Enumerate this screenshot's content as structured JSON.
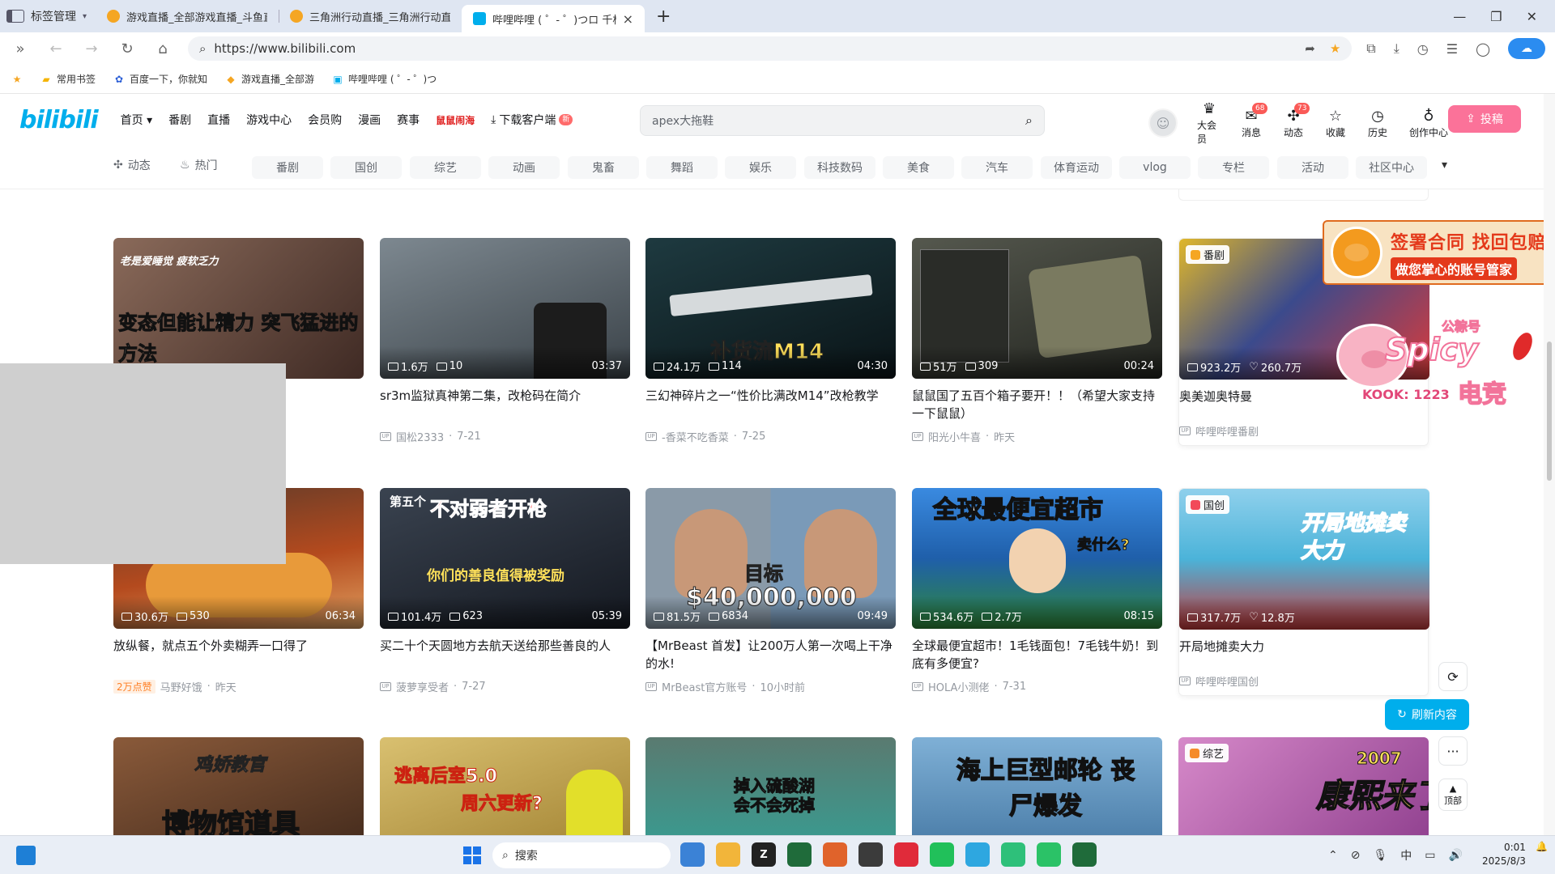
{
  "browser": {
    "tab_control_label": "标签管理",
    "tabs": [
      {
        "title": "游戏直播_全部游戏直播_斗鱼直播",
        "color": "#f5a623"
      },
      {
        "title": "三角洲行动直播_三角洲行动直播",
        "color": "#f5a623"
      },
      {
        "title": "哔哩哔哩 ( ゜- ゜)つロ 千杯~-b",
        "color": "#00aeec"
      }
    ],
    "url": "https://www.bilibili.com",
    "bookmarks": [
      {
        "label": "常用书签",
        "icon": "bookmark-folder-icon"
      },
      {
        "label": "百度一下，你就知",
        "icon": "baidu-icon"
      },
      {
        "label": "游戏直播_全部游",
        "icon": "douyu-icon"
      },
      {
        "label": "哔哩哔哩 ( ゜- ゜)つ",
        "icon": "bilibili-icon"
      }
    ]
  },
  "header": {
    "logo": "bilibili",
    "nav": [
      "首页",
      "番剧",
      "直播",
      "游戏中心",
      "会员购",
      "漫画",
      "赛事"
    ],
    "hot_label": "鼠鼠闹海",
    "download_label": "下载客户端",
    "new_badge": "新",
    "search_placeholder": "apex大拖鞋",
    "right": [
      {
        "label": "大会员",
        "icon": "vip-icon",
        "count": ""
      },
      {
        "label": "消息",
        "icon": "message-icon",
        "count": "68"
      },
      {
        "label": "动态",
        "icon": "dynamic-icon",
        "count": "73"
      },
      {
        "label": "收藏",
        "icon": "favorite-icon",
        "count": ""
      },
      {
        "label": "历史",
        "icon": "history-icon",
        "count": ""
      },
      {
        "label": "创作中心",
        "icon": "creator-icon",
        "count": ""
      }
    ],
    "upload_label": "投稿"
  },
  "channels": {
    "special": [
      {
        "label": "动态",
        "icon": "dynamic-icon"
      },
      {
        "label": "热门",
        "icon": "fire-icon"
      }
    ],
    "items": [
      "番剧",
      "国创",
      "综艺",
      "动画",
      "鬼畜",
      "舞蹈",
      "娱乐",
      "科技数码",
      "美食",
      "汽车",
      "体育运动",
      "vlog",
      "专栏",
      "活动",
      "社区中心"
    ]
  },
  "feed": {
    "row1": [
      {
        "thumb_text": "变态但能让精力 突飞猛进的方法",
        "overlay": "老是爱睡觉 疲软乏力",
        "views": "",
        "comments": "",
        "duration": "",
        "title": "",
        "up": "",
        "date": "",
        "bg": "#6b4a3f"
      },
      {
        "thumb_text": "",
        "views": "1.6万",
        "comments": "10",
        "duration": "03:37",
        "title": "sr3m监狱真神第二集，改枪码在简介",
        "up": "国松2333",
        "date": "7-21",
        "bg": "#4a5258"
      },
      {
        "thumb_text": "补货流M14",
        "views": "24.1万",
        "comments": "114",
        "duration": "04:30",
        "title": "三幻神碎片之一“性价比满改M14”改枪教学",
        "up": "-香菜不吃香菜",
        "date": "7-25",
        "bg": "#16252a"
      },
      {
        "thumb_text": "",
        "views": "51万",
        "comments": "309",
        "duration": "00:24",
        "title": "鼠鼠国了五百个箱子要开！！（希望大家支持一下鼠鼠）",
        "up": "阳光小牛喜",
        "date": "昨天",
        "bg": "#3d3f39"
      },
      {
        "thumb_text": "",
        "badge": "番剧",
        "badge_color": "#f5a623",
        "views": "923.2万",
        "likes": "260.7万",
        "title": "奥美迦奥特曼",
        "up": "哔哩哔哩番剧",
        "date": "",
        "bg": "#3b4a8c"
      }
    ],
    "row2": [
      {
        "views": "30.6万",
        "comments": "530",
        "duration": "06:34",
        "title": "放纵餐，就点五个外卖糊弄一口得了",
        "tag": "2万点赞",
        "up": "马野好饿",
        "date": "昨天",
        "bg": "#c8632c"
      },
      {
        "thumb_text": "不对弱者开枪",
        "prefix": "第五个",
        "sub": "你们的善良值得被奖励",
        "views": "101.4万",
        "comments": "623",
        "duration": "05:39",
        "title": "买二十个天圆地方去航天送给那些善良的人",
        "up": "菠萝享受者",
        "date": "7-27",
        "bg": "#2b3340"
      },
      {
        "thumb_text": "目标",
        "sub": "$40,000,000",
        "views": "81.5万",
        "comments": "6834",
        "duration": "09:49",
        "title": "【MrBeast 首发】让200万人第一次喝上干净的水!",
        "up": "MrBeast官方账号",
        "date": "10小时前",
        "bg": "#6c8aa0"
      },
      {
        "thumb_text": "全球最便宜超市",
        "sub": "卖什么?",
        "views": "534.6万",
        "comments": "2.7万",
        "duration": "08:15",
        "title": "全球最便宜超市！1毛钱面包！7毛钱牛奶！到底有多便宜?",
        "up": "HOLA小测佬",
        "date": "7-31",
        "bg": "#2f7fd1"
      },
      {
        "thumb_text": "开局地摊卖大力",
        "badge": "国创",
        "badge_color": "#f24a5a",
        "views": "317.7万",
        "likes": "12.8万",
        "title": "开局地摊卖大力",
        "up": "哔哩哔哩国创",
        "date": "",
        "bg": "#4bb3d9"
      }
    ],
    "row3": [
      {
        "thumb_text": "博物馆道具",
        "overlay": "鸡娇教官",
        "bg": "#5a3a2c"
      },
      {
        "thumb_text": "逃离后室5.0",
        "sub": "周六更新?",
        "bg": "#c9a94b"
      },
      {
        "thumb_text": "掉入硫酸湖 会不会死掉",
        "bg": "#3f8a86"
      },
      {
        "thumb_text": "海上巨型邮轮 丧尸爆发",
        "bg": "#5a8bb5"
      },
      {
        "thumb_text": "康熙来了",
        "badge": "综艺",
        "badge_color": "#f58b2b",
        "overlay": "2007",
        "bg": "#b05aa8"
      }
    ]
  },
  "ad": {
    "line1": "签署合同 找回包赔",
    "line2": "做您掌心的账号管家"
  },
  "sticker": {
    "spicy": "Spicy",
    "gongzhonghao": "公粽号",
    "dianjing": "电竞",
    "kook": "KOOK: 1223"
  },
  "side": {
    "refresh_label": "刷新内容",
    "top_label": "顶部"
  },
  "taskbar": {
    "search_label": "搜索",
    "tray_lang": "中",
    "time": "0:01",
    "date": "2025/8/3",
    "apps": [
      {
        "label": "",
        "icon": "browser-icon",
        "color": "#3b82d6"
      },
      {
        "label": "",
        "icon": "folder-icon",
        "color": "#f2b53a"
      },
      {
        "label": "Z",
        "icon": "zotero-icon",
        "color": "#222222"
      },
      {
        "label": "",
        "icon": "delta-force-icon",
        "color": "#1f6b3a"
      },
      {
        "label": "",
        "icon": "app-icon",
        "color": "#e0632b"
      },
      {
        "label": "",
        "icon": "steam-icon",
        "color": "#3b3b3b"
      },
      {
        "label": "",
        "icon": "netease-music-icon",
        "color": "#e02b3a"
      },
      {
        "label": "",
        "icon": "wechat-icon",
        "color": "#21c05a"
      },
      {
        "label": "",
        "icon": "wechat-work-icon",
        "color": "#2ea7e0"
      },
      {
        "label": "",
        "icon": "remote-icon",
        "color": "#2ec07a"
      },
      {
        "label": "",
        "icon": "kook-icon",
        "color": "#2bc267"
      },
      {
        "label": "",
        "icon": "delta-force-icon-2",
        "color": "#1f6b3a"
      }
    ]
  }
}
